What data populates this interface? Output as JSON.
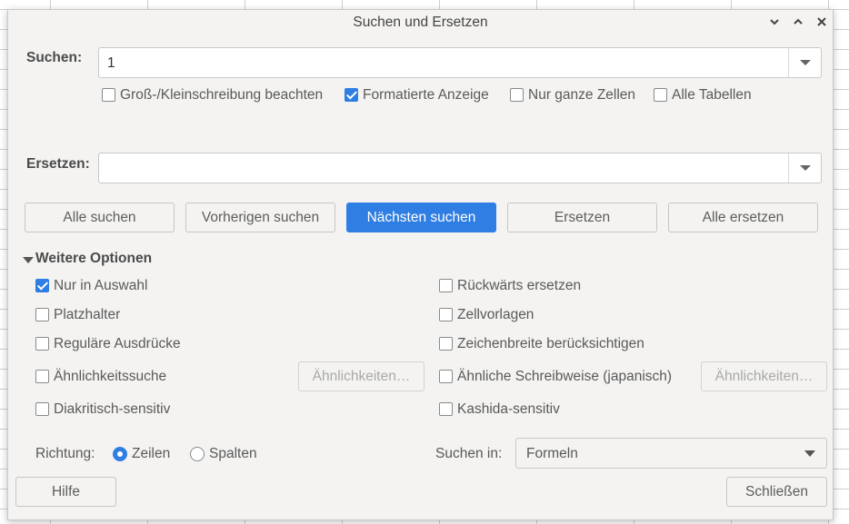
{
  "window": {
    "title": "Suchen und Ersetzen",
    "minimize": "⌄",
    "maximize": "⌃",
    "close": "✕"
  },
  "search": {
    "label": "Suchen:",
    "value": "1",
    "options": [
      {
        "label": "Groß-/Kleinschreibung beachten",
        "checked": false
      },
      {
        "label": "Formatierte Anzeige",
        "checked": true
      },
      {
        "label": "Nur ganze Zellen",
        "checked": false
      },
      {
        "label": "Alle Tabellen",
        "checked": false
      }
    ]
  },
  "replace": {
    "label": "Ersetzen:",
    "value": ""
  },
  "actions": {
    "find_all": "Alle suchen",
    "find_prev": "Vorherigen suchen",
    "find_next": "Nächsten suchen",
    "replace": "Ersetzen",
    "replace_all": "Alle ersetzen"
  },
  "more_options": {
    "title": "Weitere Optionen",
    "left": [
      {
        "label": "Nur in Auswahl",
        "checked": true
      },
      {
        "label": "Platzhalter",
        "checked": false
      },
      {
        "label": "Reguläre Ausdrücke",
        "checked": false
      },
      {
        "label": "Ähnlichkeitssuche",
        "checked": false
      },
      {
        "label": "Diakritisch-sensitiv",
        "checked": false
      }
    ],
    "right": [
      {
        "label": "Rückwärts ersetzen",
        "checked": false
      },
      {
        "label": "Zellvorlagen",
        "checked": false
      },
      {
        "label": "Zeichenbreite berücksichtigen",
        "checked": false
      },
      {
        "label": "Ähnliche Schreibweise (japanisch)",
        "checked": false
      },
      {
        "label": "Kashida-sensitiv",
        "checked": false
      }
    ],
    "similarity_button": "Ähnlichkeiten…",
    "japanese_button": "Ähnlichkeiten…",
    "direction_label": "Richtung:",
    "direction_rows": "Zeilen",
    "direction_columns": "Spalten",
    "direction_selected": "Zeilen",
    "search_in_label": "Suchen in:",
    "search_in_value": "Formeln"
  },
  "footer": {
    "help": "Hilfe",
    "close": "Schließen"
  },
  "colors": {
    "accent": "#2f7ee3",
    "dialog_bg": "#f4f3f2"
  }
}
